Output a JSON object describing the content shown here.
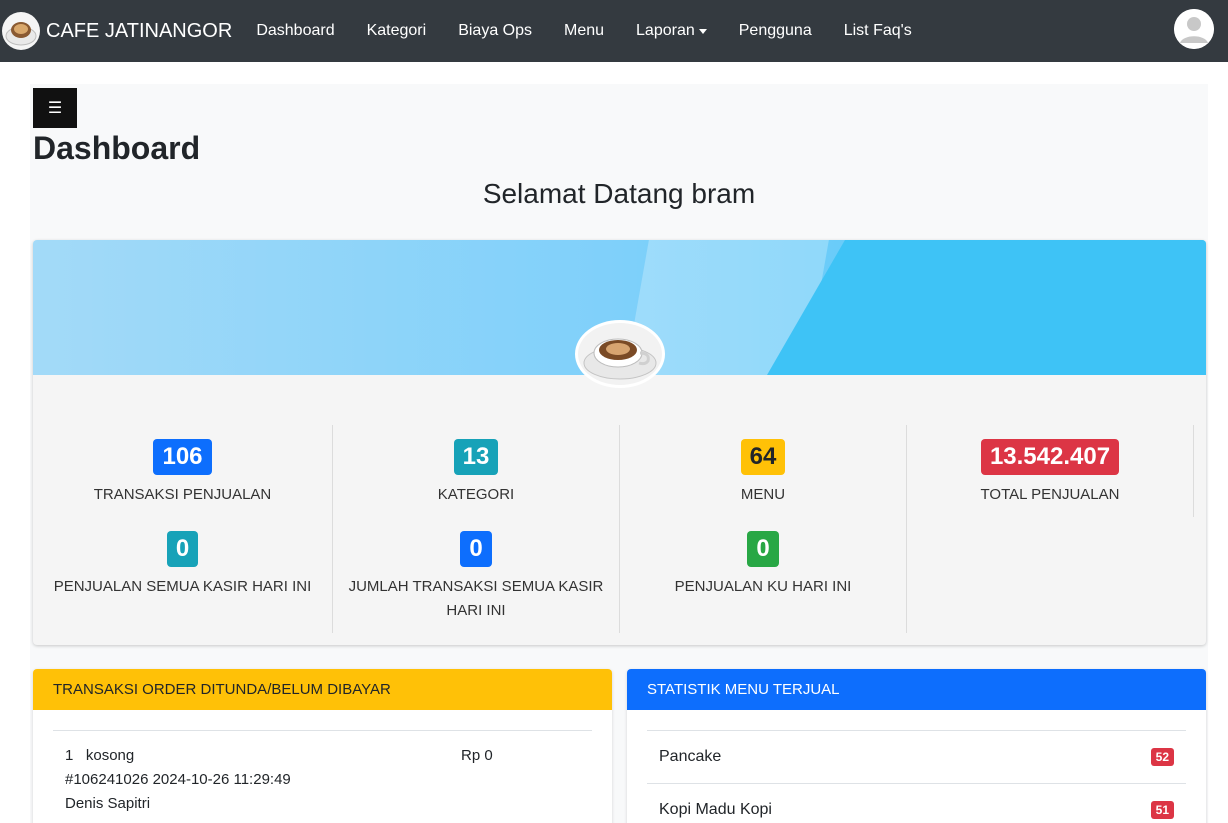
{
  "navbar": {
    "brand": "CAFE JATINANGOR",
    "links": [
      "Dashboard",
      "Kategori",
      "Biaya Ops",
      "Menu",
      "Laporan",
      "Pengguna",
      "List Faq's"
    ]
  },
  "toggle_icon": "☰",
  "page": {
    "title": "Dashboard",
    "welcome": "Selamat Datang bram"
  },
  "stats": {
    "transaksi_penjualan": {
      "value": "106",
      "label": "TRANSAKSI PENJUALAN"
    },
    "kategori": {
      "value": "13",
      "label": "KATEGORI"
    },
    "menu": {
      "value": "64",
      "label": "MENU"
    },
    "total_penjualan": {
      "value": "13.542.407",
      "label": "TOTAL PENJUALAN"
    },
    "penjualan_semua_kasir": {
      "value": "0",
      "label": "PENJUALAN SEMUA KASIR HARI INI"
    },
    "jumlah_transaksi_kasir": {
      "value": "0",
      "label": "JUMLAH TRANSAKSI SEMUA KASIR HARI INI"
    },
    "penjualan_ku": {
      "value": "0",
      "label": "PENJUALAN KU HARI INI"
    }
  },
  "pending_orders": {
    "title": "TRANSAKSI ORDER DITUNDA/BELUM DIBAYAR",
    "items": [
      {
        "no": "1",
        "name": "kosong",
        "price": "Rp 0",
        "code": "#106241026 2024-10-26 11:29:49",
        "customer": "Denis Sapitri"
      }
    ]
  },
  "menu_stats": {
    "title": "STATISTIK MENU TERJUAL",
    "items": [
      {
        "name": "Pancake",
        "count": "52"
      },
      {
        "name": "Kopi Madu Kopi",
        "count": "51"
      }
    ]
  },
  "colors": {
    "navbar": "#343a40",
    "warning": "#ffc107",
    "primary": "#0d6efd",
    "danger": "#dc3545",
    "info": "#17a2b8",
    "success": "#28a745"
  }
}
